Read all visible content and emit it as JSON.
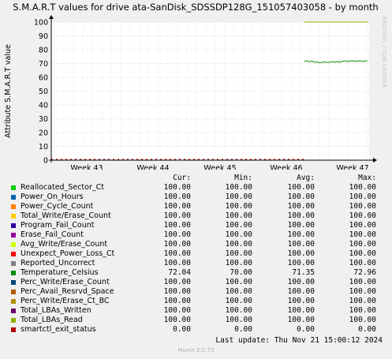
{
  "colors": {
    "background": "#f0f0f0",
    "plot_bg": "#ffffff",
    "grid_major": "#e4a0a0",
    "grid_minor": "#f0c0c0",
    "axis": "#000000"
  },
  "chart_data": {
    "type": "line",
    "title": "S.M.A.R.T values for drive ata-SanDisk_SDSSDP128G_151057403058 - by month",
    "ylabel": "Attribute S.M.A.R.T value",
    "watermark": "RRDTOOL / TOBI OETIKER",
    "ylim": [
      0,
      100
    ],
    "yticks": [
      0,
      10,
      20,
      30,
      40,
      50,
      60,
      70,
      80,
      90,
      100
    ],
    "xticks": [
      "Week 43",
      "Week 44",
      "Week 45",
      "Week 46",
      "Week 47"
    ],
    "grid": true,
    "series": [
      {
        "name": "Reallocated_Sector_Ct",
        "color": "#00cc00",
        "cur": "100.00",
        "min": "100.00",
        "avg": "100.00",
        "max": "100.00"
      },
      {
        "name": "Power_On_Hours",
        "color": "#0066b3",
        "cur": "100.00",
        "min": "100.00",
        "avg": "100.00",
        "max": "100.00"
      },
      {
        "name": "Power_Cycle_Count",
        "color": "#ff8000",
        "cur": "100.00",
        "min": "100.00",
        "avg": "100.00",
        "max": "100.00"
      },
      {
        "name": "Total_Write/Erase_Count",
        "color": "#ffcc00",
        "cur": "100.00",
        "min": "100.00",
        "avg": "100.00",
        "max": "100.00"
      },
      {
        "name": "Program_Fail_Count",
        "color": "#330099",
        "cur": "100.00",
        "min": "100.00",
        "avg": "100.00",
        "max": "100.00"
      },
      {
        "name": "Erase_Fail_Count",
        "color": "#990099",
        "cur": "100.00",
        "min": "100.00",
        "avg": "100.00",
        "max": "100.00"
      },
      {
        "name": "Avg_Write/Erase_Count",
        "color": "#ccff00",
        "cur": "100.00",
        "min": "100.00",
        "avg": "100.00",
        "max": "100.00"
      },
      {
        "name": "Unexpect_Power_Loss_Ct",
        "color": "#ff0000",
        "cur": "100.00",
        "min": "100.00",
        "avg": "100.00",
        "max": "100.00"
      },
      {
        "name": "Reported_Uncorrect",
        "color": "#808080",
        "cur": "100.00",
        "min": "100.00",
        "avg": "100.00",
        "max": "100.00"
      },
      {
        "name": "Temperature_Celsius",
        "color": "#008f00",
        "cur": "72.04",
        "min": "70.00",
        "avg": "71.35",
        "max": "72.96"
      },
      {
        "name": "Perc_Write/Erase_Count",
        "color": "#00487d",
        "cur": "100.00",
        "min": "100.00",
        "avg": "100.00",
        "max": "100.00"
      },
      {
        "name": "Perc_Avail_Resrvd_Space",
        "color": "#b35a00",
        "cur": "100.00",
        "min": "100.00",
        "avg": "100.00",
        "max": "100.00"
      },
      {
        "name": "Perc_Write/Erase_Ct_BC",
        "color": "#b38f00",
        "cur": "100.00",
        "min": "100.00",
        "avg": "100.00",
        "max": "100.00"
      },
      {
        "name": "Total_LBAs_Written",
        "color": "#6b006b",
        "cur": "100.00",
        "min": "100.00",
        "avg": "100.00",
        "max": "100.00"
      },
      {
        "name": "Total_LBAs_Read",
        "color": "#8fb300",
        "cur": "100.00",
        "min": "100.00",
        "avg": "100.00",
        "max": "100.00"
      },
      {
        "name": "smartctl_exit_status",
        "color": "#b30000",
        "cur": "0.00",
        "min": "0.00",
        "avg": "0.00",
        "max": "0.00"
      }
    ],
    "temperature_trace": [
      71.5,
      72,
      71.2,
      71.8,
      70.9,
      71.1,
      70.6,
      70.8,
      71.2,
      70.7,
      70.9,
      71.4,
      71.0,
      71.3,
      70.9,
      71.6,
      71.9,
      71.4,
      71.8,
      72.0,
      71.6,
      71.7,
      72.0,
      71.5,
      71.8,
      72.04
    ],
    "col_headers": {
      "cur": "Cur:",
      "min": "Min:",
      "avg": "Avg:",
      "max": "Max:"
    }
  },
  "footer": {
    "last_update": "Last update: Thu Nov 21 15:00:12 2024",
    "version": "Munin 2.0.73"
  }
}
